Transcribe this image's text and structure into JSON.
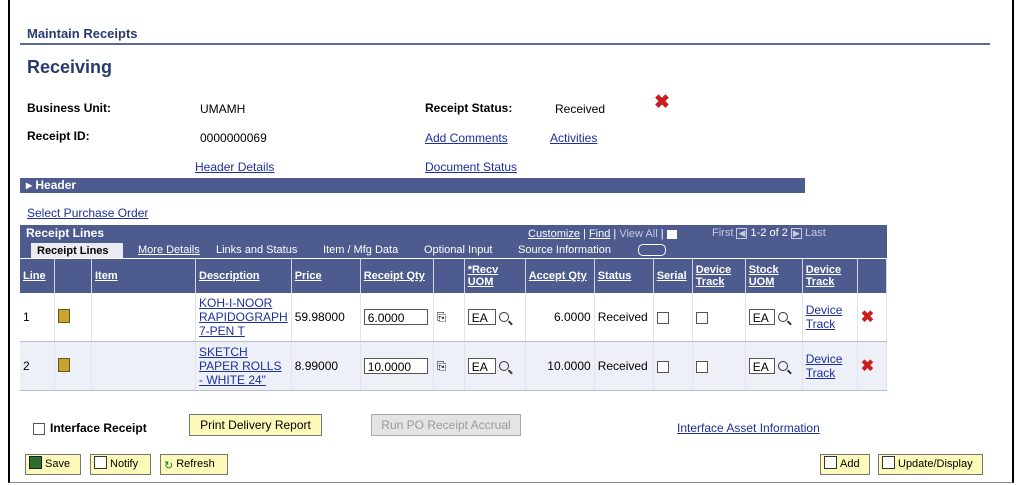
{
  "page": {
    "section_title": "Maintain Receipts",
    "title": "Receiving"
  },
  "header": {
    "business_unit_label": "Business Unit:",
    "business_unit": "UMAMH",
    "receipt_id_label": "Receipt ID:",
    "receipt_id": "0000000069",
    "receipt_status_label": "Receipt Status:",
    "receipt_status": "Received",
    "add_comments": "Add Comments",
    "activities": "Activities",
    "header_details": "Header Details",
    "document_status": "Document Status",
    "collapse_label": "Header"
  },
  "select_po": "Select Purchase Order",
  "grid": {
    "title": "Receipt Lines",
    "customize": "Customize",
    "find": "Find",
    "view_all": "View All",
    "first": "First",
    "range": "1-2 of 2",
    "last": "Last",
    "tabs": [
      "Receipt Lines",
      "More Details",
      "Links and Status",
      "Item / Mfg Data",
      "Optional Input",
      "Source Information"
    ],
    "columns": [
      "Line",
      "",
      "Item",
      "Description",
      "Price",
      "Receipt Qty",
      "",
      "*Recv UOM",
      "Accept Qty",
      "Status",
      "Serial",
      "Device Track",
      "Stock UOM",
      "Device Track",
      ""
    ],
    "rows": [
      {
        "line": "1",
        "item": "",
        "description": "KOH-I-NOOR RAPIDOGRAPH 7-PEN T",
        "price": "59.98000",
        "receipt_qty": "6.0000",
        "recv_uom": "EA",
        "accept_qty": "6.0000",
        "status": "Received",
        "stock_uom": "EA",
        "device_track_link": "Device Track"
      },
      {
        "line": "2",
        "item": "",
        "description": "SKETCH PAPER ROLLS - WHITE 24\"",
        "price": "8.99000",
        "receipt_qty": "10.0000",
        "recv_uom": "EA",
        "accept_qty": "10.0000",
        "status": "Received",
        "stock_uom": "EA",
        "device_track_link": "Device Track"
      }
    ]
  },
  "footer": {
    "interface_receipt": "Interface Receipt",
    "print_delivery": "Print Delivery Report",
    "run_accrual": "Run PO Receipt Accrual",
    "interface_asset": "Interface Asset Information"
  },
  "toolbar": {
    "save": "Save",
    "notify": "Notify",
    "refresh": "Refresh",
    "add": "Add",
    "update": "Update/Display"
  }
}
